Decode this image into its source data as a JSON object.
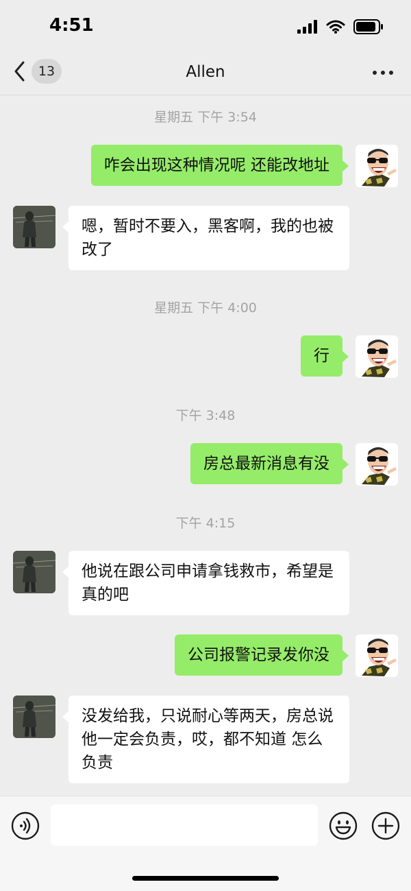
{
  "status_bar": {
    "time": "4:51"
  },
  "nav": {
    "back_count": "13",
    "title": "Allen"
  },
  "timestamps": [
    "星期五 下午 3:54",
    "星期五 下午 4:00",
    "下午 3:48",
    "下午 4:15"
  ],
  "messages": [
    {
      "from": "me",
      "text": "咋会出现这种情况呢 还能改地址"
    },
    {
      "from": "them",
      "text": "嗯，暂时不要入，黑客啊，我的也被改了"
    },
    {
      "from": "me",
      "text": "行"
    },
    {
      "from": "me",
      "text": "房总最新消息有没"
    },
    {
      "from": "them",
      "text": "他说在跟公司申请拿钱救市，希望是真的吧"
    },
    {
      "from": "me",
      "text": "公司报警记录发你没"
    },
    {
      "from": "them",
      "text": "没发给我，只说耐心等两天，房总说他一定会负责，哎，都不知道 怎么负责"
    }
  ],
  "input": {
    "value": ""
  },
  "icons": {
    "back": "chevron-left-icon",
    "more": "more-dots-icon",
    "voice": "voice-icon",
    "emoji": "emoji-icon",
    "add": "plus-icon",
    "signal": "signal-icon",
    "wifi": "wifi-icon",
    "battery": "battery-icon"
  },
  "colors": {
    "background": "#ededed",
    "my_bubble": "#95ec69",
    "their_bubble": "#ffffff",
    "timestamp": "#a3a3a3"
  }
}
